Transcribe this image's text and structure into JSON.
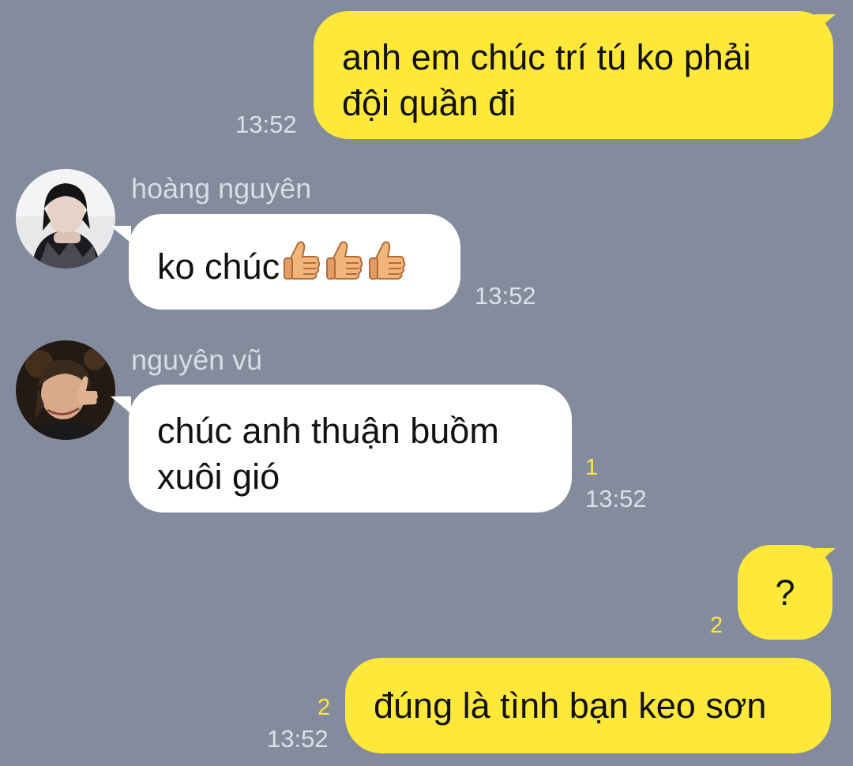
{
  "messages": [
    {
      "direction": "outgoing",
      "text_line1": "anh em chúc trí tú ko phải",
      "text_line2": "đội quần đi",
      "time": "13:52"
    },
    {
      "direction": "incoming",
      "sender": "hoàng nguyên",
      "text": "ko chúc",
      "emoji": "thumbs-up x3",
      "time": "13:52"
    },
    {
      "direction": "incoming",
      "sender": "nguyên vũ",
      "text_line1": "chúc anh thuận buồm",
      "text_line2": "xuôi gió",
      "read_count": "1",
      "time": "13:52"
    },
    {
      "direction": "outgoing",
      "text": "?",
      "read_count": "2"
    },
    {
      "direction": "outgoing",
      "text": "đúng là tình bạn keo sơn",
      "read_count": "2",
      "time": "13:52"
    }
  ],
  "colors": {
    "background": "#838b9c",
    "outgoing_bubble": "#fee93b",
    "incoming_bubble": "#ffffff",
    "read_count": "#fee93b",
    "timestamp": "#dde0e8"
  }
}
